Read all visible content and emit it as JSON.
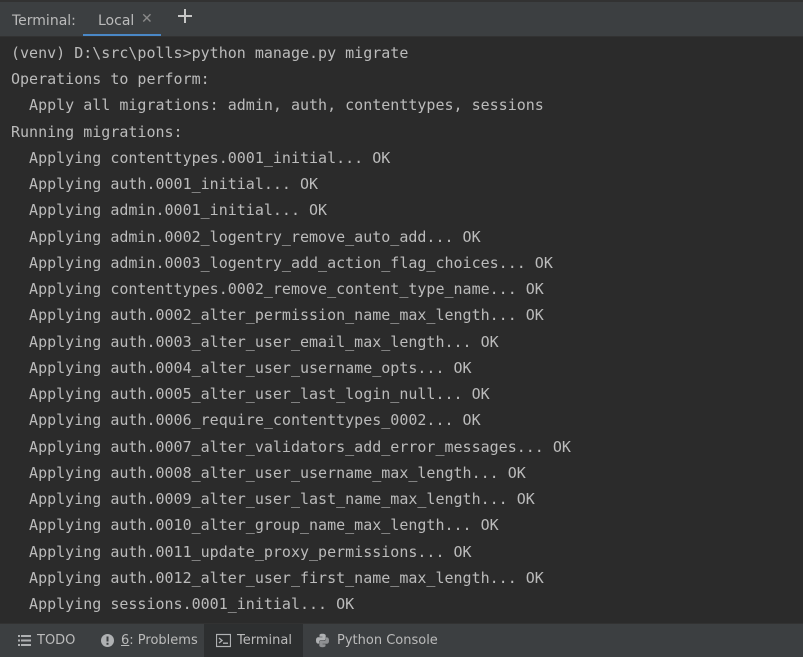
{
  "header": {
    "title": "Terminal:",
    "tab_label": "Local",
    "close_glyph": "✕",
    "add_icon": "plus-icon"
  },
  "terminal": {
    "lines": [
      "(venv) D:\\src\\polls>python manage.py migrate",
      "Operations to perform:",
      "  Apply all migrations: admin, auth, contenttypes, sessions",
      "Running migrations:",
      "  Applying contenttypes.0001_initial... OK",
      "  Applying auth.0001_initial... OK",
      "  Applying admin.0001_initial... OK",
      "  Applying admin.0002_logentry_remove_auto_add... OK",
      "  Applying admin.0003_logentry_add_action_flag_choices... OK",
      "  Applying contenttypes.0002_remove_content_type_name... OK",
      "  Applying auth.0002_alter_permission_name_max_length... OK",
      "  Applying auth.0003_alter_user_email_max_length... OK",
      "  Applying auth.0004_alter_user_username_opts... OK",
      "  Applying auth.0005_alter_user_last_login_null... OK",
      "  Applying auth.0006_require_contenttypes_0002... OK",
      "  Applying auth.0007_alter_validators_add_error_messages... OK",
      "  Applying auth.0008_alter_user_username_max_length... OK",
      "  Applying auth.0009_alter_user_last_name_max_length... OK",
      "  Applying auth.0010_alter_group_name_max_length... OK",
      "  Applying auth.0011_update_proxy_permissions... OK",
      "  Applying auth.0012_alter_user_first_name_max_length... OK",
      "  Applying sessions.0001_initial... OK"
    ]
  },
  "bottom_bar": {
    "todo_label": "TODO",
    "problems_number": "6",
    "problems_label": ": Problems",
    "terminal_label": "Terminal",
    "python_console_label": "Python Console"
  },
  "colors": {
    "background": "#2b2b2b",
    "panel": "#3c3f41",
    "text": "#bbbbbb",
    "accent": "#4a88c7"
  }
}
